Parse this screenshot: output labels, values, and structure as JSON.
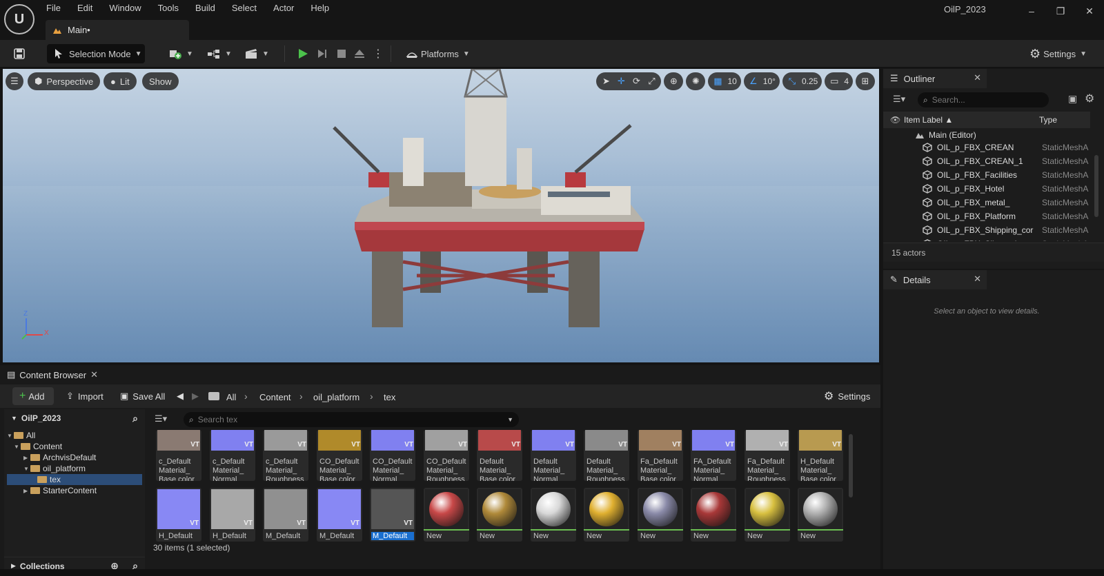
{
  "window": {
    "logo_text": "U",
    "project_name": "OilP_2023",
    "minimize": "–",
    "restore": "❐",
    "close": "✕"
  },
  "menu": [
    "File",
    "Edit",
    "Window",
    "Tools",
    "Build",
    "Select",
    "Actor",
    "Help"
  ],
  "level_tab": {
    "label": "Main•"
  },
  "toolbar": {
    "selection_mode": "Selection Mode",
    "platforms": "Platforms",
    "settings": "Settings"
  },
  "viewport": {
    "menu_icon": "hamburger-icon",
    "perspective": "Perspective",
    "lit": "Lit",
    "show": "Show",
    "grid_snap": "10",
    "rotation_snap": "10°",
    "scale_snap": "0.25",
    "camera_speed": "4",
    "axis_x": "X",
    "axis_z": "Z"
  },
  "outliner": {
    "title": "Outliner",
    "search_placeholder": "Search...",
    "col_label": "Item Label ▲",
    "col_type": "Type",
    "root": "Main (Editor)",
    "rows": [
      {
        "label": "OIL_p_FBX_CREAN",
        "type": "StaticMeshA"
      },
      {
        "label": "OIL_p_FBX_CREAN_1",
        "type": "StaticMeshA"
      },
      {
        "label": "OIL_p_FBX_Facilities",
        "type": "StaticMeshA"
      },
      {
        "label": "OIL_p_FBX_Hotel",
        "type": "StaticMeshA"
      },
      {
        "label": "OIL_p_FBX_metal_",
        "type": "StaticMeshA"
      },
      {
        "label": "OIL_p_FBX_Platform",
        "type": "StaticMeshA"
      },
      {
        "label": "OIL_p_FBX_Shipping_cor",
        "type": "StaticMeshA"
      },
      {
        "label": "OIL_p_FBX_Silver_pipe",
        "type": "StaticMeshA"
      }
    ],
    "footer": "15 actors"
  },
  "details": {
    "title": "Details",
    "empty_text": "Select an object to view details."
  },
  "content_browser": {
    "title": "Content Browser",
    "add": "Add",
    "import": "Import",
    "save_all": "Save All",
    "breadcrumb": [
      "All",
      "Content",
      "oil_platform",
      "tex"
    ],
    "settings": "Settings",
    "tree_root": "OilP_2023",
    "tree": {
      "all": "All",
      "content": "Content",
      "archvis": "ArchvisDefault",
      "oil_platform": "oil_platform",
      "tex": "tex",
      "starter": "StarterContent"
    },
    "collections": "Collections",
    "search_placeholder": "Search tex",
    "row1": [
      {
        "l1": "c_Default",
        "l2": "Material_",
        "l3": "Base color",
        "color": "#8a7a72"
      },
      {
        "l1": "c_Default",
        "l2": "Material_",
        "l3": "Normal",
        "color": "#8080f0"
      },
      {
        "l1": "c_Default",
        "l2": "Material_",
        "l3": "Roughness",
        "color": "#9a9a9a"
      },
      {
        "l1": "CO_Default",
        "l2": "Material_",
        "l3": "Base color",
        "color": "#b08a2a"
      },
      {
        "l1": "CO_Default",
        "l2": "Material_",
        "l3": "Normal",
        "color": "#8080f0"
      },
      {
        "l1": "CO_Default",
        "l2": "Material_",
        "l3": "Roughness",
        "color": "#a0a0a0"
      },
      {
        "l1": "Default",
        "l2": "Material_",
        "l3": "Base color",
        "color": "#b84a4a"
      },
      {
        "l1": "Default",
        "l2": "Material_",
        "l3": "Normal",
        "color": "#8080f0"
      },
      {
        "l1": "Default",
        "l2": "Material_",
        "l3": "Roughness",
        "color": "#8a8a8a"
      },
      {
        "l1": "Fa_Default",
        "l2": "Material_",
        "l3": "Base color",
        "color": "#a08060"
      },
      {
        "l1": "FA_Default",
        "l2": "Material_",
        "l3": "Normal",
        "color": "#8080f0"
      },
      {
        "l1": "Fa_Default",
        "l2": "Material_",
        "l3": "Roughness",
        "color": "#b0b0b0"
      },
      {
        "l1": "H_Default",
        "l2": "Material_",
        "l3": "Base color",
        "color": "#b89a50"
      }
    ],
    "row2": [
      {
        "label": "H_Default",
        "kind": "tex",
        "color": "#8888f4",
        "bar": "#2a2a2a"
      },
      {
        "label": "H_Default",
        "kind": "tex",
        "color": "#a8a8a8",
        "bar": "#2a2a2a"
      },
      {
        "label": "M_Default",
        "kind": "tex",
        "color": "#909090",
        "bar": "#2a2a2a"
      },
      {
        "label": "M_Default",
        "kind": "tex",
        "color": "#8888f4",
        "bar": "#2a2a2a"
      },
      {
        "label": "M_Default",
        "kind": "tex",
        "color": "#555555",
        "bar": "#2a2a2a",
        "selected": true
      },
      {
        "label": "New",
        "kind": "sphere",
        "color": "#c84848",
        "bar": "#6cbf52"
      },
      {
        "label": "New",
        "kind": "sphere",
        "color": "#b08a3a",
        "bar": "#6cbf52"
      },
      {
        "label": "New",
        "kind": "sphere",
        "color": "#d8d8d8",
        "bar": "#6cbf52"
      },
      {
        "label": "New",
        "kind": "sphere",
        "color": "#e0b030",
        "bar": "#6cbf52"
      },
      {
        "label": "New",
        "kind": "sphere",
        "color": "#8a8aa8",
        "bar": "#6cbf52"
      },
      {
        "label": "New",
        "kind": "sphere",
        "color": "#a83838",
        "bar": "#6cbf52"
      },
      {
        "label": "New",
        "kind": "sphere",
        "color": "#d8c040",
        "bar": "#6cbf52"
      },
      {
        "label": "New",
        "kind": "sphere",
        "color": "#b0b0b0",
        "bar": "#6cbf52"
      }
    ],
    "status": "30 items (1 selected)"
  }
}
